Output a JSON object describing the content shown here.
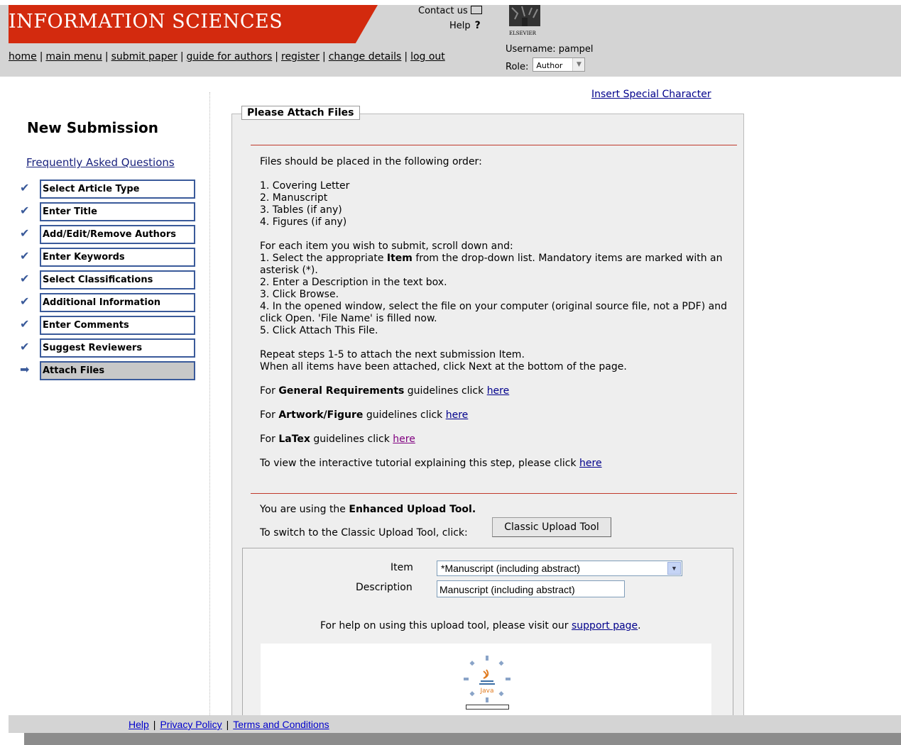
{
  "header": {
    "title": "INFORMATION SCIENCES",
    "contact_label": "Contact us",
    "help_label": "Help",
    "help_mark": "?",
    "publisher": "ELSEVIER",
    "nav": [
      "home",
      "main menu",
      "submit paper",
      "guide for authors",
      "register",
      "change details",
      "log out"
    ],
    "username_label": "Username:",
    "username": "pampel",
    "role_label": "Role:",
    "role_value": "Author"
  },
  "sidebar": {
    "title": "New Submission",
    "faq": "Frequently Asked Questions",
    "steps": [
      {
        "label": "Select Article Type",
        "mark": "✔"
      },
      {
        "label": "Enter Title",
        "mark": "✔"
      },
      {
        "label": "Add/Edit/Remove Authors",
        "mark": "✔"
      },
      {
        "label": "Enter Keywords",
        "mark": "✔"
      },
      {
        "label": "Select Classifications",
        "mark": "✔"
      },
      {
        "label": "Additional Information",
        "mark": "✔"
      },
      {
        "label": "Enter Comments",
        "mark": "✔"
      },
      {
        "label": "Suggest Reviewers",
        "mark": "✔"
      },
      {
        "label": "Attach Files",
        "mark": "➡"
      }
    ]
  },
  "main": {
    "special_char": "Insert Special Character",
    "panel_title": "Please Attach Files",
    "intro": "Files should be placed in the following order:",
    "order": [
      "1. Covering Letter",
      "2. Manuscript",
      "3. Tables (if any)",
      "4. Figures (if any)"
    ],
    "each_item": "For each item you wish to submit, scroll down and:",
    "step1_a": "1. Select the appropriate ",
    "step1_bold": "Item",
    "step1_b": " from the drop-down list. Mandatory items are marked with an asterisk (*).",
    "step2": "2. Enter a Description in the text box.",
    "step3": "3. Click Browse.",
    "step4": "4. In the opened window, select the file on your computer (original source file, not a PDF) and click Open. 'File Name' is filled now.",
    "step5": "5. Click Attach This File.",
    "repeat1": "Repeat steps 1-5 to attach the next submission Item.",
    "repeat2": "When all items have been attached, click Next at the bottom of the page.",
    "for": "For",
    "gen_bold": "General Requirements",
    "art_bold": "Artwork/Figure",
    "latex_bold": "LaTex",
    "guidelines_click": " guidelines click ",
    "here": "here",
    "tutorial": "To view the interactive tutorial explaining this step, please click ",
    "using_a": "You are using the ",
    "using_bold": "Enhanced Upload Tool.",
    "switch": "To switch to the Classic Upload Tool, click:",
    "classic_btn": "Classic Upload Tool",
    "item_label": "Item",
    "item_value": "*Manuscript (including abstract)",
    "desc_label": "Description",
    "desc_value": "Manuscript (including abstract)",
    "support_a": "For help on using this upload tool, please visit our ",
    "support_link": "support page",
    "support_b": "."
  },
  "footer": {
    "links": [
      "Help",
      "Privacy Policy",
      "Terms and Conditions"
    ]
  },
  "colors": {
    "banner": "#d32a0e",
    "header_bg": "#d4d4d4",
    "step_border": "#3a5a9a",
    "red_rule": "#c0392b"
  },
  "icons": [
    "envelope-icon",
    "help-icon",
    "elsevier-tree-logo",
    "check-icon",
    "arrow-right-icon",
    "java-loading-icon"
  ]
}
